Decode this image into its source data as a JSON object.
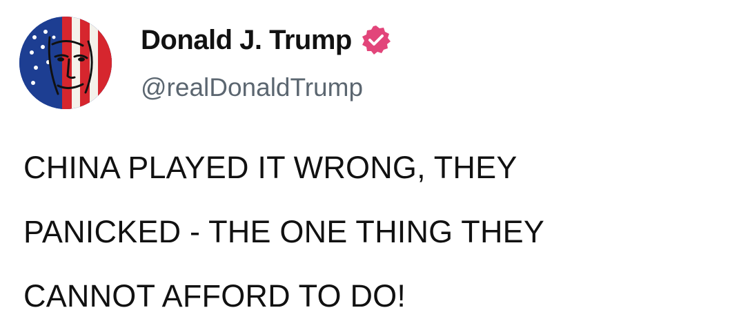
{
  "post": {
    "author": {
      "display_name": "Donald J. Trump",
      "handle": "@realDonaldTrump",
      "verified": true,
      "verified_badge_color": "#e2457a",
      "avatar_icon": "flag-portrait-avatar"
    },
    "text_lines": [
      "CHINA PLAYED IT WRONG, THEY",
      "PANICKED - THE ONE THING THEY",
      "CANNOT AFFORD TO DO!"
    ]
  }
}
